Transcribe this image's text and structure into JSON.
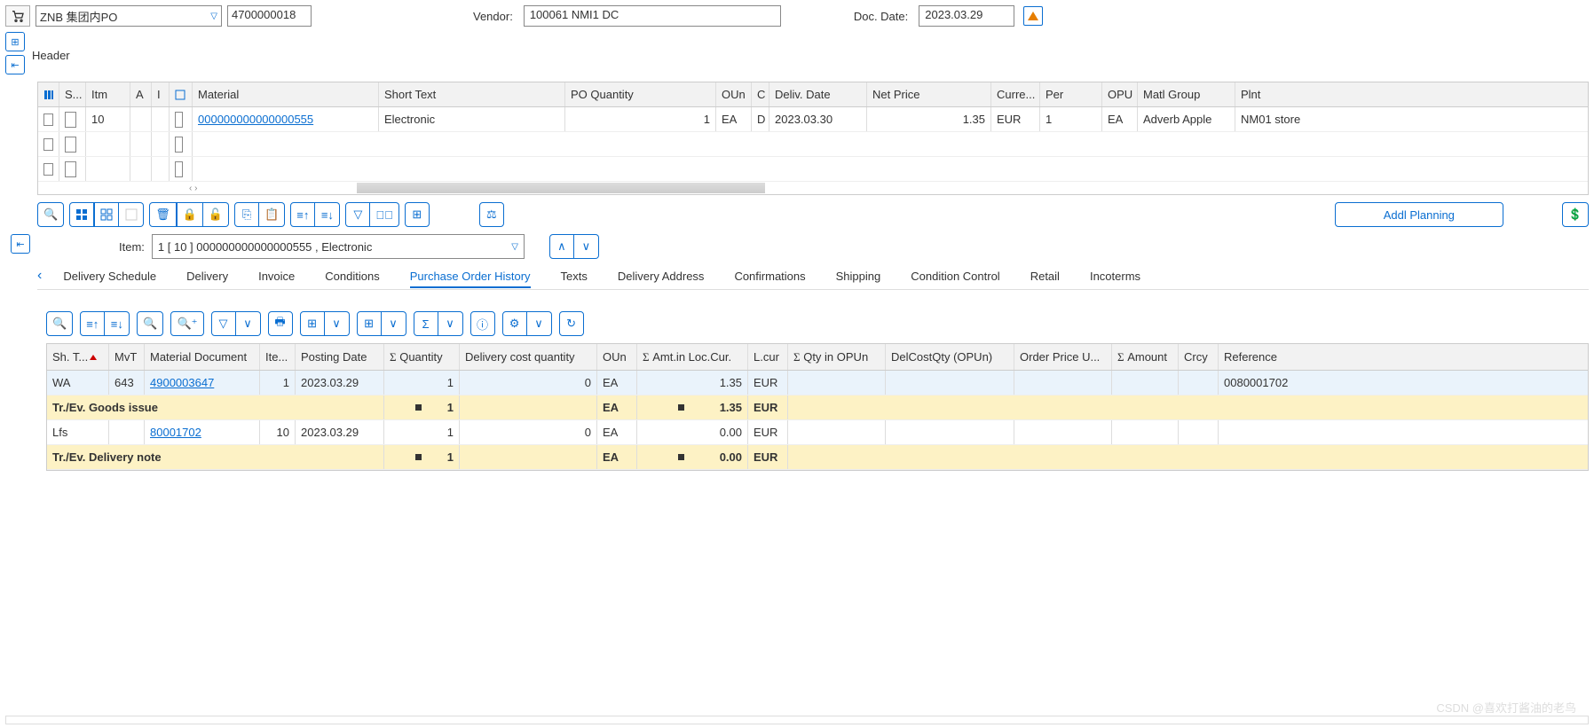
{
  "header": {
    "doc_type": "ZNB 集团内PO",
    "po_number": "4700000018",
    "vendor_label": "Vendor:",
    "vendor": "100061 NMI1 DC",
    "docdate_label": "Doc. Date:",
    "doc_date": "2023.03.29",
    "header_label": "Header"
  },
  "grid": {
    "cols": {
      "s": "S...",
      "itm": "Itm",
      "a": "A",
      "i": "I",
      "mat": "Material",
      "short": "Short Text",
      "qty": "PO Quantity",
      "oun": "OUn",
      "c": "C",
      "deliv": "Deliv. Date",
      "net": "Net Price",
      "curr": "Curre...",
      "per": "Per",
      "opu": "OPU",
      "matg": "Matl Group",
      "plnt": "Plnt"
    },
    "row": {
      "itm": "10",
      "material": "000000000000000555",
      "short": "Electronic",
      "qty": "1",
      "oun": "EA",
      "c": "D",
      "deliv": "2023.03.30",
      "net": "1.35",
      "curr": "EUR",
      "per": "1",
      "opu": "EA",
      "matg": "Adverb Apple",
      "plnt": "NM01 store"
    }
  },
  "buttons": {
    "addl": "Addl Planning"
  },
  "item_detail": {
    "label": "Item:",
    "value": "1 [ 10 ] 000000000000000555 , Electronic"
  },
  "tabs": [
    "Delivery Schedule",
    "Delivery",
    "Invoice",
    "Conditions",
    "Purchase Order History",
    "Texts",
    "Delivery Address",
    "Confirmations",
    "Shipping",
    "Condition Control",
    "Retail",
    "Incoterms"
  ],
  "active_tab": 4,
  "hist": {
    "cols": {
      "sht": "Sh. T...",
      "mvt": "MvT",
      "mdoc": "Material Document",
      "ite": "Ite...",
      "pdate": "Posting Date",
      "qty": "Quantity",
      "dcq": "Delivery cost quantity",
      "oun": "OUn",
      "amt": "Amt.in Loc.Cur.",
      "lcur": "L.cur",
      "qopu": "Qty in OPUn",
      "dcqo": "DelCostQty (OPUn)",
      "opu": "Order Price U...",
      "amount": "Amount",
      "crcy": "Crcy",
      "ref": "Reference"
    },
    "rows": [
      {
        "type": "data",
        "sht": "WA",
        "mvt": "643",
        "mdoc": "4900003647",
        "ite": "1",
        "pdate": "2023.03.29",
        "qty": "1",
        "dcq": "0",
        "oun": "EA",
        "amt": "1.35",
        "lcur": "EUR",
        "ref": "0080001702"
      },
      {
        "type": "sum",
        "label": "Tr./Ev. Goods issue",
        "qty": "1",
        "oun": "EA",
        "amt": "1.35",
        "lcur": "EUR"
      },
      {
        "type": "data",
        "sht": "Lfs",
        "mvt": "",
        "mdoc": "80001702",
        "ite": "10",
        "pdate": "2023.03.29",
        "qty": "1",
        "dcq": "0",
        "oun": "EA",
        "amt": "0.00",
        "lcur": "EUR",
        "ref": ""
      },
      {
        "type": "sum",
        "label": "Tr./Ev. Delivery note",
        "qty": "1",
        "oun": "EA",
        "amt": "0.00",
        "lcur": "EUR"
      }
    ]
  },
  "watermark": "CSDN @喜欢打酱油的老鸟"
}
